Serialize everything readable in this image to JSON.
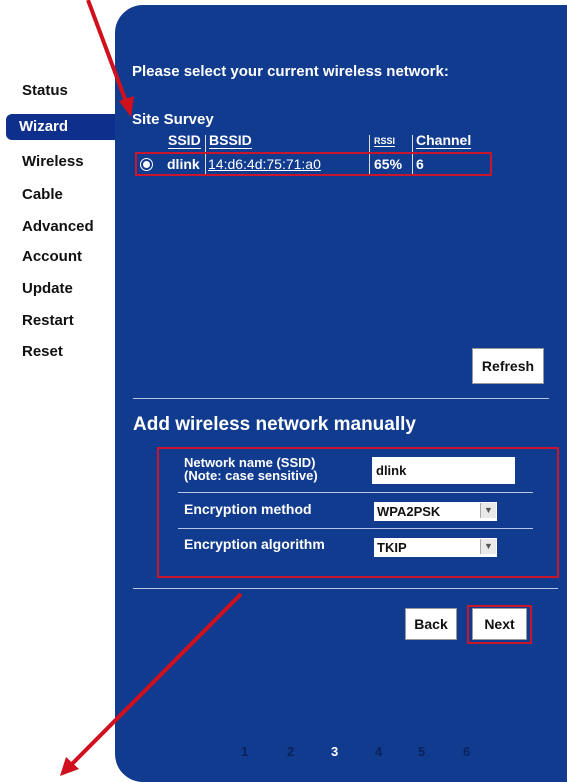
{
  "sidebar": {
    "items": [
      {
        "label": "Status"
      },
      {
        "label": "Wizard"
      },
      {
        "label": "Wireless"
      },
      {
        "label": "Cable"
      },
      {
        "label": "Advanced"
      },
      {
        "label": "Account"
      },
      {
        "label": "Update"
      },
      {
        "label": "Restart"
      },
      {
        "label": "Reset"
      }
    ],
    "active": "Wizard"
  },
  "main": {
    "title": "Please select your current wireless network:",
    "site_survey": {
      "label": "Site Survey",
      "columns": [
        "SSID",
        "BSSID",
        "RSSI",
        "Channel"
      ],
      "rows": [
        {
          "ssid": "dlink",
          "bssid": "14:d6:4d:75:71:a0",
          "rssi": "65%",
          "channel": "6"
        }
      ]
    },
    "refresh_label": "Refresh",
    "manual": {
      "title": "Add wireless network manually",
      "network_name_label_1": "Network name (SSID)",
      "network_name_label_2": "(Note: case sensitive)",
      "network_name_value": "dlink",
      "encryption_method_label": "Encryption method",
      "encryption_method_value": "WPA2PSK",
      "encryption_algorithm_label": "Encryption algorithm",
      "encryption_algorithm_value": "TKIP"
    },
    "back_label": "Back",
    "next_label": "Next",
    "pages": [
      "1",
      "2",
      "3",
      "4",
      "5",
      "6"
    ],
    "current_page": "3"
  },
  "colors": {
    "panel": "#113b8f",
    "active_item": "#0e2f8c",
    "highlight": "#c9162d",
    "annotation_arrow": "#d0101c"
  }
}
